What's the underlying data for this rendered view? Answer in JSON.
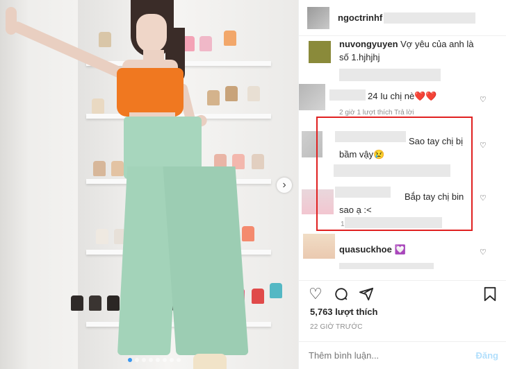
{
  "header": {
    "username": "ngoctrinhf"
  },
  "comments": [
    {
      "user": "nuvongyuyen",
      "text": "Vợ yêu của anh là số 1.hjhjhj"
    },
    {
      "user": "",
      "text": "24 Iu chị nè❤️❤️",
      "meta": "2 giờ  1 lượt thích  Trả lời"
    },
    {
      "user": "",
      "text": "Sao tay chị bị bầm vậy😢"
    },
    {
      "user": "",
      "text": "Bắp tay chị bin sao ạ :<",
      "meta": "1"
    },
    {
      "user": "quasuckhoe",
      "text": "💟"
    }
  ],
  "stats": {
    "likes": "5,763 lượt thích",
    "time": "22 GIỜ TRƯỚC"
  },
  "comment_box": {
    "placeholder": "Thêm bình luận...",
    "post_label": "Đăng"
  },
  "icons": {
    "like": "heart-icon",
    "comment": "comment-icon",
    "share": "paper-plane-icon",
    "save": "bookmark-icon",
    "next": "chevron-right-icon"
  },
  "colors": {
    "highlight_box": "#e02020",
    "post_button": "#b2dffc",
    "active_dot": "#3897f0"
  }
}
